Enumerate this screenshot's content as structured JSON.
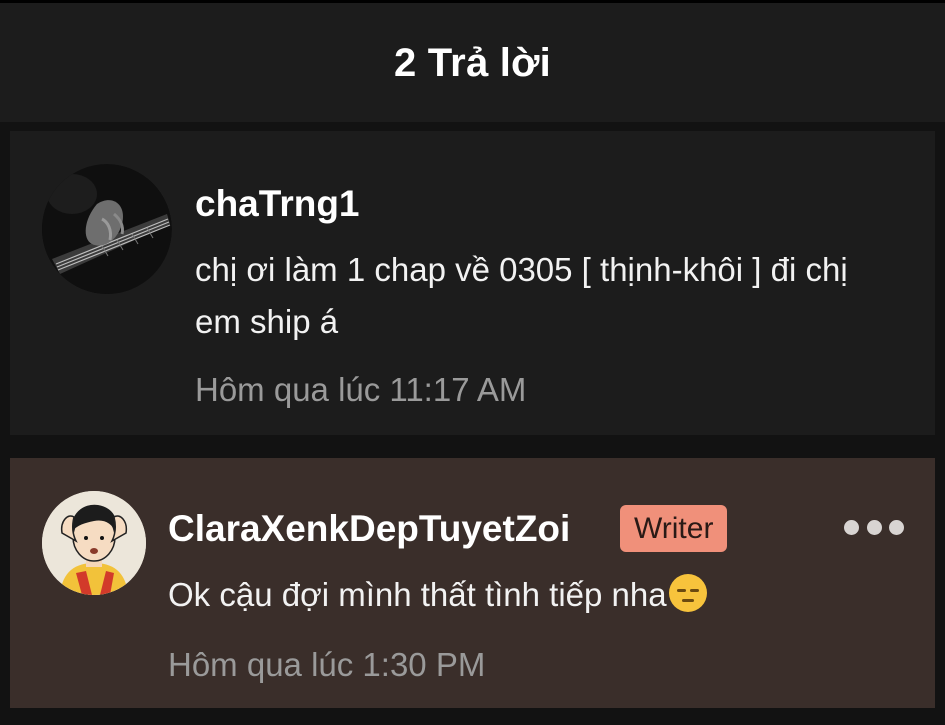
{
  "header": {
    "title": "2 Trả lời"
  },
  "comments": [
    {
      "username": "chaTrng1",
      "text": "chị ơi làm 1 chap về 0305 [ thịnh-khôi ] đi chị em ship á",
      "timestamp": "Hôm qua lúc 11:17 AM",
      "avatar_icon": "guitar-photo-avatar"
    },
    {
      "username": "ClaraXenkDepTuyetZoi",
      "badge": "Writer",
      "text": "Ok cậu đợi mình thất tình tiếp nha",
      "emoji": "pensive-face-emoji",
      "timestamp": "Hôm qua lúc 1:30 PM",
      "avatar_icon": "cartoon-boy-avatar",
      "more_icon": "more-options-icon"
    }
  ],
  "colors": {
    "background": "#121212",
    "header": "#1c1c1c",
    "comment_bg": "#1c1c1c",
    "highlight_comment_bg": "#3a2e2a",
    "badge": "#f0907a",
    "timestamp": "#9a9a9a"
  }
}
